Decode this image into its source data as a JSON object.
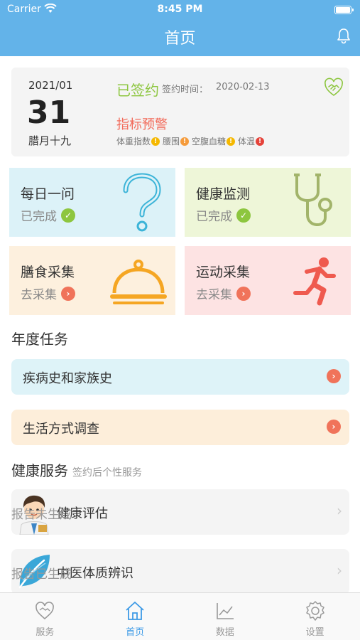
{
  "status_bar": {
    "carrier": "Carrier",
    "time": "8:45 PM"
  },
  "nav": {
    "title": "首页",
    "right_icon": "bell-icon"
  },
  "sign_card": {
    "year_month": "2021/01",
    "day": "31",
    "lunar": "腊月十九",
    "signed": "已签约",
    "sign_time_label": "签约时间：",
    "sign_time": "2020-02-13",
    "warning": "指标预警",
    "indicators": [
      {
        "label": "体重指数",
        "mark": "!",
        "color": "#f5b800"
      },
      {
        "label": "腰围",
        "mark": "!",
        "color": "#f59b3b"
      },
      {
        "label": "空腹血糖",
        "mark": "!",
        "color": "#f5b800"
      },
      {
        "label": "体温",
        "mark": "!",
        "color": "#e5433a"
      }
    ]
  },
  "tiles": [
    {
      "name": "每日一问",
      "status": "已完成",
      "icon": "question-icon"
    },
    {
      "name": "健康监测",
      "status": "已完成",
      "icon": "stethoscope-icon"
    },
    {
      "name": "膳食采集",
      "status": "去采集",
      "icon": "cloche-icon"
    },
    {
      "name": "运动采集",
      "status": "去采集",
      "icon": "runner-icon"
    }
  ],
  "annual": {
    "title": "年度任务",
    "tasks": [
      {
        "label": "疾病史和家族史"
      },
      {
        "label": "生活方式调查"
      }
    ]
  },
  "services": {
    "title": "健康服务",
    "subtitle": "签约后个性服务",
    "items": [
      {
        "label": "健康评估",
        "status": "报告未生成",
        "icon": "doctor-avatar-icon"
      },
      {
        "label": "中医体质辨识",
        "status": "报告已生成",
        "icon": "leaf-icon"
      }
    ]
  },
  "tabbar": [
    {
      "label": "服务",
      "icon": "heart-hands-icon",
      "active": false
    },
    {
      "label": "首页",
      "icon": "home-icon",
      "active": true
    },
    {
      "label": "数据",
      "icon": "chart-icon",
      "active": false
    },
    {
      "label": "设置",
      "icon": "gear-icon",
      "active": false
    }
  ],
  "colors": {
    "header": "#63b3e9",
    "accent": "#3d9ae6",
    "done_green": "#8dc63f",
    "action_orange": "#f0735a",
    "warning_red": "#f26b5b"
  }
}
